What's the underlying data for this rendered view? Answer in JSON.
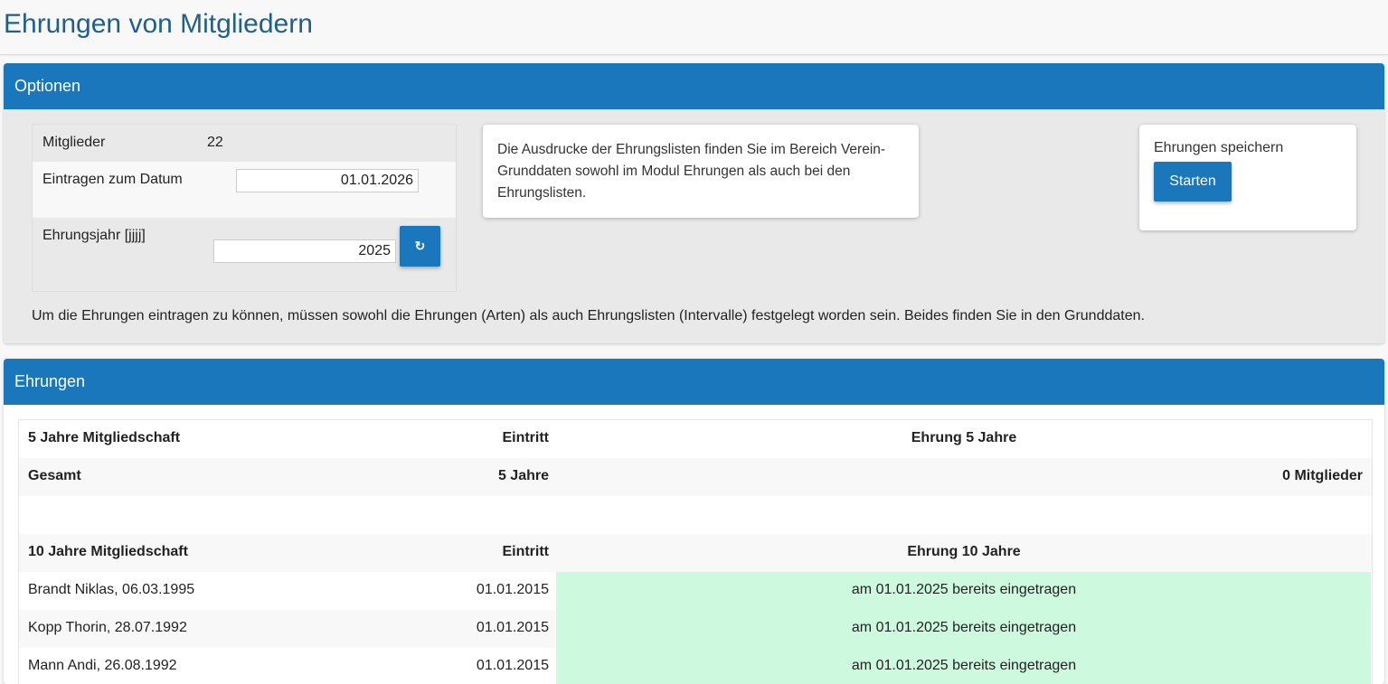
{
  "page": {
    "title": "Ehrungen von Mitgliedern"
  },
  "options_panel": {
    "heading": "Optionen",
    "members_label": "Mitglieder",
    "members_count": "22",
    "date_label": "Eintragen zum Datum",
    "date_value": "01.01.2026",
    "year_label": "Ehrungsjahr [jjjj]",
    "year_value": "2025",
    "refresh_icon": "refresh-icon",
    "info_text": "Die Ausdrucke der Ehrungslisten finden Sie im Bereich Verein-Grunddaten sowohl im Modul Ehrungen als auch bei den Ehrungslisten.",
    "save_label": "Ehrungen speichern",
    "start_button": "Starten",
    "hint": "Um die Ehrungen eintragen zu können, müssen sowohl die Ehrungen (Arten) als auch Ehrungslisten (Intervalle) festgelegt worden sein. Beides finden Sie in den Grunddaten."
  },
  "honors_panel": {
    "heading": "Ehrungen",
    "group5": {
      "title": "5 Jahre Mitgliedschaft",
      "col_entry": "Eintritt",
      "col_honor": "Ehrung 5 Jahre",
      "total_label": "Gesamt",
      "total_years": "5 Jahre",
      "total_members": "0 Mitglieder"
    },
    "group10": {
      "title": "10 Jahre Mitgliedschaft",
      "col_entry": "Eintritt",
      "col_honor": "Ehrung 10 Jahre",
      "rows": [
        {
          "name": "Brandt Niklas, 06.03.1995",
          "entry": "01.01.2015",
          "status": "am 01.01.2025 bereits eingetragen"
        },
        {
          "name": "Kopp Thorin, 28.07.1992",
          "entry": "01.01.2015",
          "status": "am 01.01.2025 bereits eingetragen"
        },
        {
          "name": "Mann Andi, 26.08.1992",
          "entry": "01.01.2015",
          "status": "am 01.01.2025 bereits eingetragen"
        }
      ]
    }
  },
  "colors": {
    "accent": "#1a77bb",
    "title": "#1f5f8b",
    "status_bg": "#cdf9df"
  }
}
